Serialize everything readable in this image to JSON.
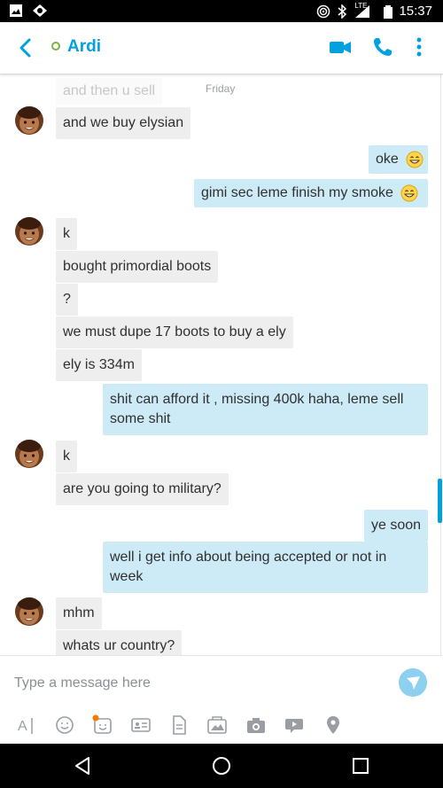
{
  "status_bar": {
    "time": "15:37",
    "network": "LTE"
  },
  "header": {
    "contact_name": "Ardi",
    "presence": "online"
  },
  "chat": {
    "day_label": "Friday",
    "messages": [
      {
        "dir": "in",
        "text": "and then u sell",
        "faded": true
      },
      {
        "dir": "in",
        "text": "and we buy elysian",
        "avatar": true
      },
      {
        "dir": "out",
        "text": "oke",
        "emoji": "grin-emoji"
      },
      {
        "dir": "out",
        "text": "gimi sec leme finish my smoke",
        "emoji": "grin-emoji"
      },
      {
        "dir": "in",
        "text": "k",
        "avatar": true
      },
      {
        "dir": "in",
        "text": "bought primordial boots"
      },
      {
        "dir": "in",
        "text": "?"
      },
      {
        "dir": "in",
        "text": "we must dupe 17 boots to buy a ely"
      },
      {
        "dir": "in",
        "text": "ely is 334m"
      },
      {
        "dir": "out",
        "text": "shit can afford it , missing 400k haha, leme sell some shit"
      },
      {
        "dir": "in",
        "text": "k",
        "avatar": true
      },
      {
        "dir": "in",
        "text": "are you going to military?"
      },
      {
        "dir": "out",
        "text": "ye soon"
      },
      {
        "dir": "out",
        "text": "well i get info about being accepted or not in week"
      },
      {
        "dir": "in",
        "text": "mhm",
        "avatar": true
      },
      {
        "dir": "in",
        "text": "whats ur country?"
      }
    ]
  },
  "composer": {
    "placeholder": "Type a message here",
    "tools": [
      "text-format-icon",
      "emoticon-icon",
      "moji-icon",
      "contact-card-icon",
      "file-icon",
      "photo-gallery-icon",
      "camera-icon",
      "video-message-icon",
      "location-icon"
    ]
  },
  "colors": {
    "accent": "#00a1de",
    "incoming_bubble": "#eeeeee",
    "outgoing_bubble": "#cdeaf7",
    "presence": "#7cb342"
  }
}
